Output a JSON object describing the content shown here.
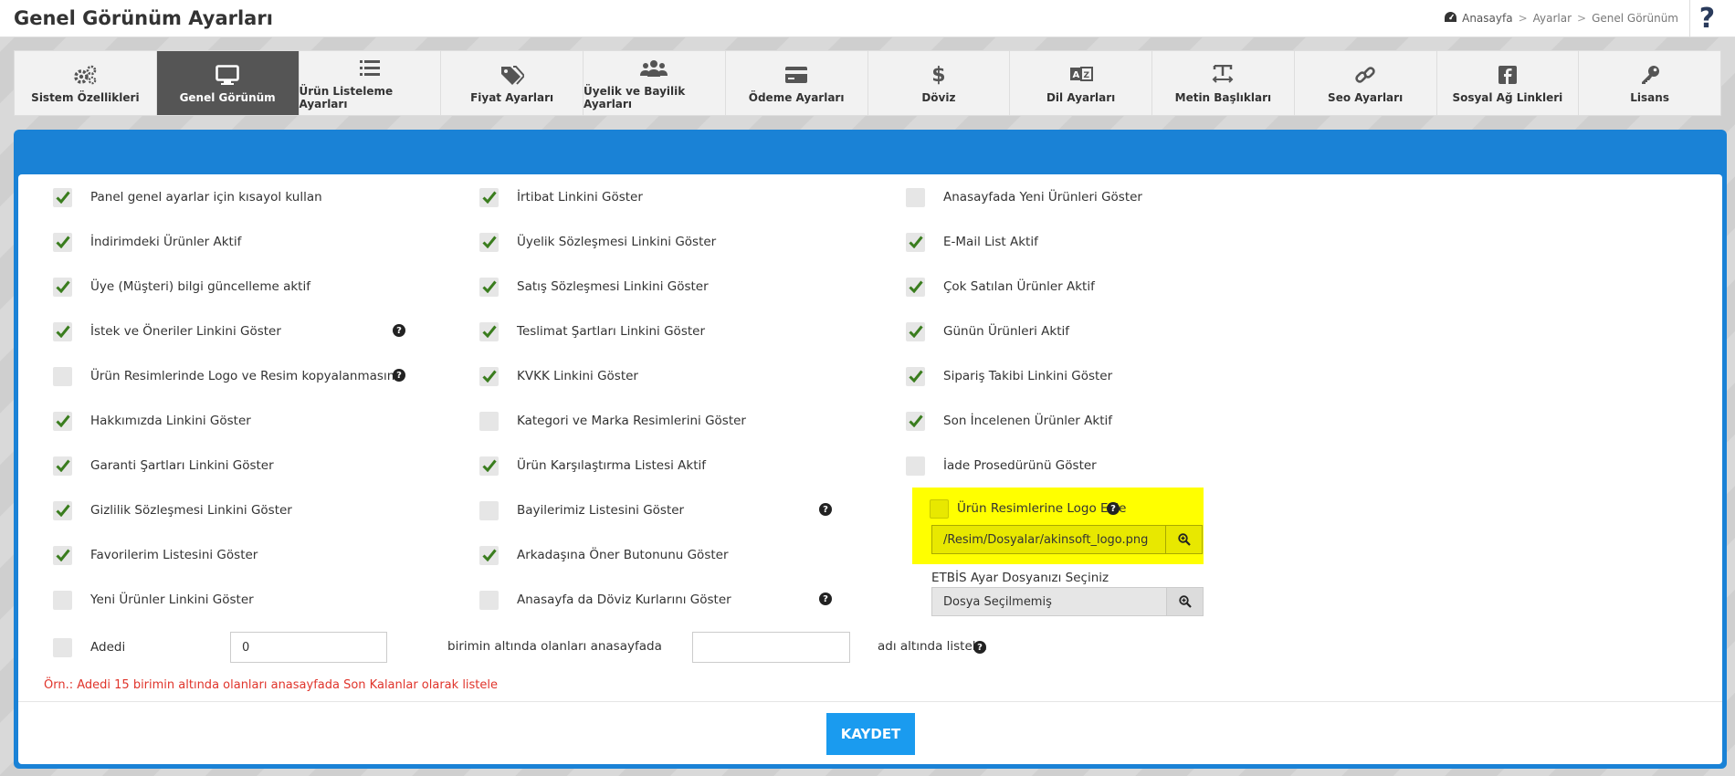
{
  "header": {
    "title": "Genel Görünüm Ayarları",
    "breadcrumb": {
      "home": "Anasayfa",
      "separator": ">",
      "middle": "Ayarlar",
      "current": "Genel Görünüm"
    },
    "help_glyph": "?"
  },
  "tabs": [
    {
      "label": "Sistem Özellikleri",
      "icon": "gears-icon"
    },
    {
      "label": "Genel Görünüm",
      "icon": "monitor-icon",
      "active": true
    },
    {
      "label": "Ürün Listeleme Ayarları",
      "icon": "list-icon"
    },
    {
      "label": "Fiyat Ayarları",
      "icon": "tags-icon"
    },
    {
      "label": "Üyelik ve Bayilik Ayarları",
      "icon": "users-icon"
    },
    {
      "label": "Ödeme Ayarları",
      "icon": "credit-card-icon"
    },
    {
      "label": "Döviz",
      "icon": "dollar-icon"
    },
    {
      "label": "Dil Ayarları",
      "icon": "language-icon"
    },
    {
      "label": "Metin Başlıkları",
      "icon": "text-height-icon"
    },
    {
      "label": "Seo Ayarları",
      "icon": "link-icon"
    },
    {
      "label": "Sosyal Ağ Linkleri",
      "icon": "facebook-icon"
    },
    {
      "label": "Lisans",
      "icon": "key-icon"
    }
  ],
  "columns": [
    [
      {
        "label": "Panel genel ayarlar için kısayol kullan",
        "checked": true
      },
      {
        "label": "İndirimdeki Ürünler Aktif",
        "checked": true
      },
      {
        "label": "Üye (Müşteri) bilgi güncelleme aktif",
        "checked": true
      },
      {
        "label": "İstek ve Öneriler Linkini Göster",
        "checked": true,
        "help": true
      },
      {
        "label": "Ürün Resimlerinde Logo ve Resim kopyalanmasın",
        "checked": false,
        "help": true
      },
      {
        "label": "Hakkımızda Linkini Göster",
        "checked": true
      },
      {
        "label": "Garanti Şartları Linkini Göster",
        "checked": true
      },
      {
        "label": "Gizlilik Sözleşmesi Linkini Göster",
        "checked": true
      },
      {
        "label": "Favorilerim Listesini Göster",
        "checked": true
      },
      {
        "label": "Yeni Ürünler Linkini Göster",
        "checked": false
      }
    ],
    [
      {
        "label": "İrtibat Linkini Göster",
        "checked": true
      },
      {
        "label": "Üyelik Sözleşmesi Linkini Göster",
        "checked": true
      },
      {
        "label": "Satış Sözleşmesi Linkini Göster",
        "checked": true
      },
      {
        "label": "Teslimat Şartları Linkini Göster",
        "checked": true
      },
      {
        "label": "KVKK Linkini Göster",
        "checked": true
      },
      {
        "label": "Kategori ve Marka Resimlerini Göster",
        "checked": false
      },
      {
        "label": "Ürün Karşılaştırma Listesi Aktif",
        "checked": true
      },
      {
        "label": "Bayilerimiz Listesini Göster",
        "checked": false,
        "help": true
      },
      {
        "label": "Arkadaşına Öner Butonunu Göster",
        "checked": true
      },
      {
        "label": "Anasayfa da Döviz Kurlarını Göster",
        "checked": false,
        "help": true
      }
    ],
    [
      {
        "label": "Anasayfada Yeni Ürünleri Göster",
        "checked": false
      },
      {
        "label": "E-Mail List Aktif",
        "checked": true
      },
      {
        "label": "Çok Satılan Ürünler Aktif",
        "checked": true
      },
      {
        "label": "Günün Ürünleri Aktif",
        "checked": true
      },
      {
        "label": "Sipariş Takibi Linkini Göster",
        "checked": true
      },
      {
        "label": "Son İncelenen Ürünler Aktif",
        "checked": true
      },
      {
        "label": "İade Prosedürünü Göster",
        "checked": false
      }
    ]
  ],
  "logo": {
    "label": "Ürün Resimlerine Logo Ekle",
    "checked": false,
    "path": "/Resim/Dosyalar/akinsoft_logo.png"
  },
  "etbis": {
    "label": "ETBİS Ayar Dosyanızı Seçiniz",
    "file": "Dosya Seçilmemiş"
  },
  "stock_rule": {
    "label": "Adedi",
    "checked": false,
    "quantity": "0",
    "middle_text": "birimin altında olanları anasayfada",
    "list_name": "",
    "end_text": "adı altında listele."
  },
  "example": "Örn.: Adedi 15 birimin altında olanları anasayfada Son Kalanlar olarak listele",
  "save_label": "KAYDET",
  "colors": {
    "accent": "#1a82d6",
    "check": "#3a7d1e",
    "highlight": "#ffff00",
    "example_text": "#e0342b",
    "save_button": "#1a9bef"
  }
}
